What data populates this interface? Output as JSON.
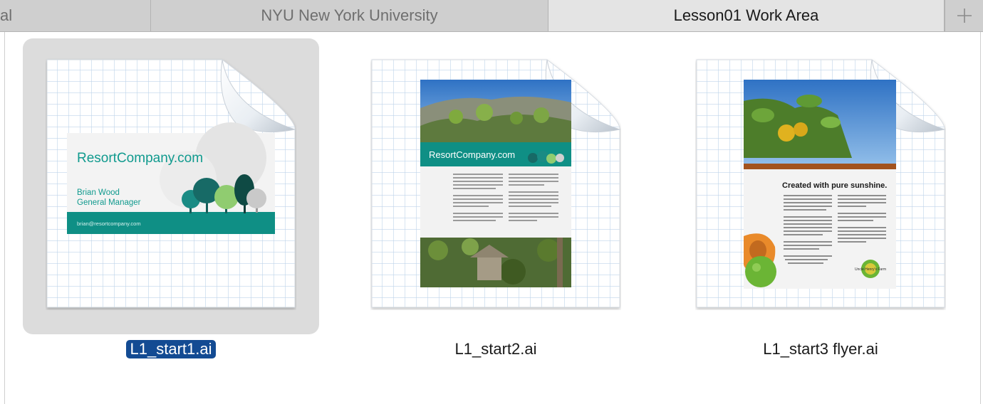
{
  "tabs": [
    {
      "label": "al"
    },
    {
      "label": "NYU New York University"
    },
    {
      "label": "Lesson01 Work Area"
    }
  ],
  "add_tab_icon": "plus-icon",
  "files": [
    {
      "name": "L1_start1.ai",
      "selected": true,
      "preview": {
        "brand": "ResortCompany.com",
        "person": "Brian Wood",
        "role": "General Manager",
        "email": "brian@resortcompany.com"
      }
    },
    {
      "name": "L1_start2.ai",
      "selected": false,
      "preview": {
        "brand": "ResortCompany.com"
      }
    },
    {
      "name": "L1_start3 flyer.ai",
      "selected": false,
      "preview": {
        "headline": "Created with pure sunshine.",
        "badge": "Uncle Henry's Farm"
      }
    }
  ],
  "colors": {
    "teal": "#0f8f85",
    "selection": "#134b93"
  }
}
